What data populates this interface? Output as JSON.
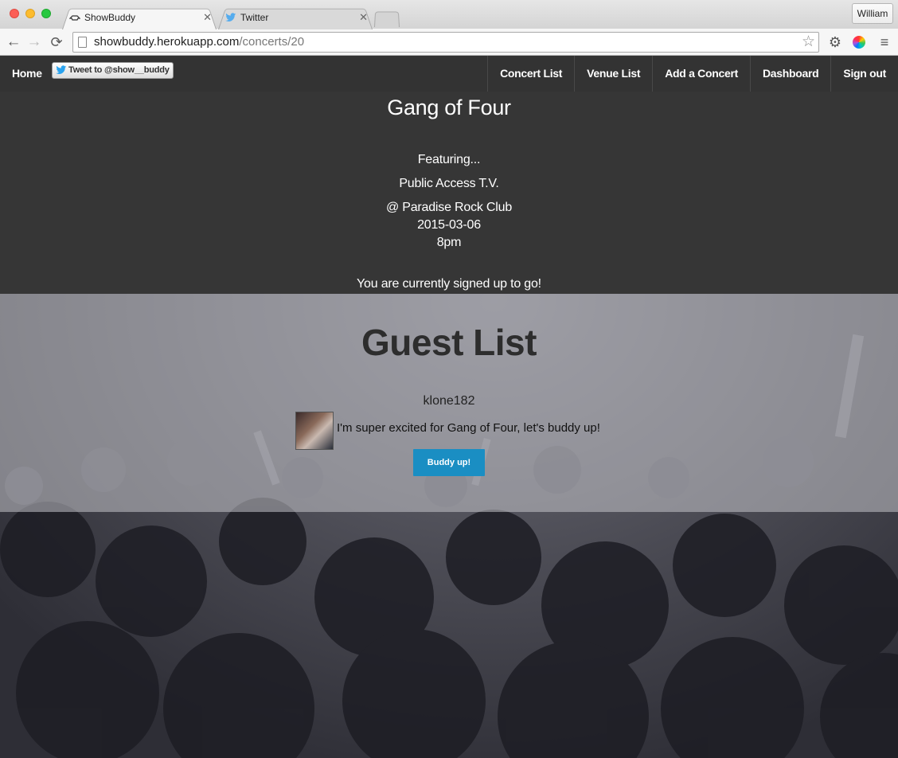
{
  "browser": {
    "tabs": [
      {
        "label": "ShowBuddy",
        "icon": "showbuddy-favicon"
      },
      {
        "label": "Twitter",
        "icon": "twitter-favicon"
      }
    ],
    "profile_name": "William",
    "url": {
      "host": "showbuddy.herokuapp.com",
      "path": "/concerts/20"
    }
  },
  "site_nav": {
    "home": "Home",
    "tweet_button": "Tweet to @show__buddy",
    "links": [
      "Concert List",
      "Venue List",
      "Add a Concert",
      "Dashboard",
      "Sign out"
    ]
  },
  "concert": {
    "title": "Gang of Four",
    "featuring_label": "Featuring...",
    "opener": "Public Access T.V.",
    "venue": "@ Paradise Rock Club",
    "date": "2015-03-06",
    "time": "8pm",
    "status": "You are currently signed up to go!"
  },
  "guest_list": {
    "heading": "Guest List",
    "guests": [
      {
        "username": "klone182",
        "message": "I'm super excited for Gang of Four, let's buddy up!",
        "button": "Buddy up!"
      }
    ]
  },
  "colors": {
    "nav_bg": "#333333",
    "accent_button": "#1a8ec3"
  }
}
